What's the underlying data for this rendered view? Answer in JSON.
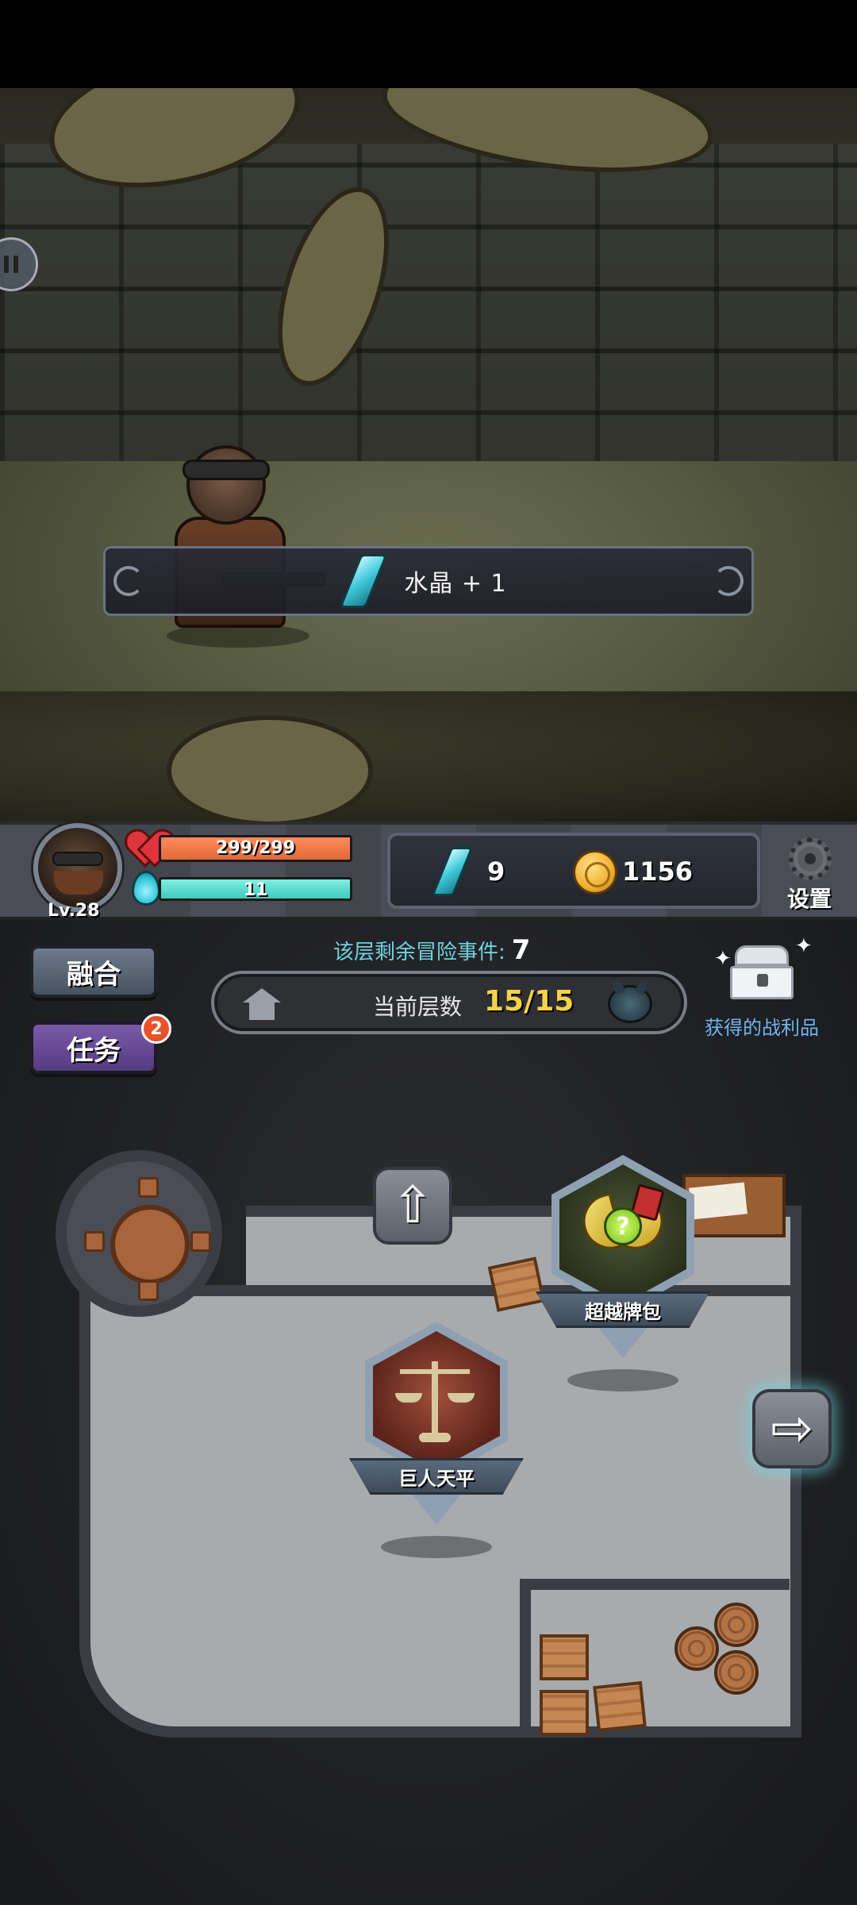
{
  "battle": {
    "reward_toast": {
      "text": "水晶 + 1",
      "icon": "crystal-icon"
    }
  },
  "status": {
    "level": "Lv.28",
    "hp": {
      "text": "299/299",
      "fraction": 1.0,
      "color": "#e06a3b"
    },
    "mp": {
      "text": "11",
      "fraction": 1.0,
      "color": "#3ecbbd"
    },
    "crystals": "9",
    "gold": "1156",
    "settings_label": "设置"
  },
  "dungeon": {
    "fuse_label": "融合",
    "task_label": "任务",
    "task_badge": "2",
    "events_label": "该层剩余冒险事件:",
    "events_count": "7",
    "floor_label": "当前层数",
    "floor_value": "15/15",
    "loot_label": "获得的战利品",
    "nodes": [
      {
        "label": "超越牌包",
        "icon": "card-pack-icon"
      },
      {
        "label": "巨人天平",
        "icon": "scale-icon"
      }
    ]
  }
}
